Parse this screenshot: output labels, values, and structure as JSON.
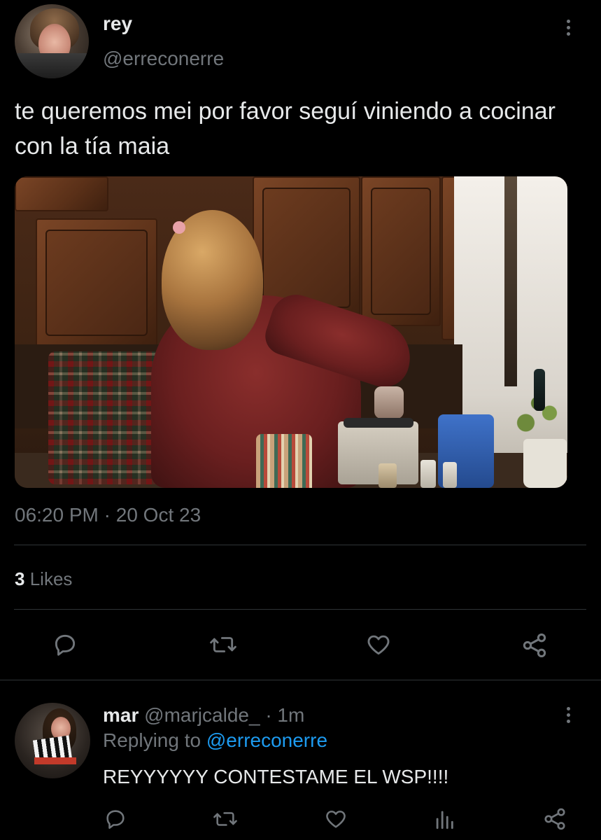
{
  "tweet": {
    "author_name": "rey",
    "author_handle": "@erreconerre",
    "text": "te queremos mei por favor seguí viniendo a cocinar con la tía maia",
    "time": "06:20 PM",
    "separator": "·",
    "date": "20 Oct 23",
    "likes_count": "3",
    "likes_label": "Likes",
    "photo_icon": "kitchen-photo",
    "actions": [
      "reply-icon",
      "retweet-icon",
      "like-icon",
      "share-icon"
    ]
  },
  "reply": {
    "author_name": "mar",
    "author_handle": "@marjcalde_",
    "time_separator": "·",
    "time_ago": "1m",
    "replying_to_label": "Replying to",
    "replying_to_handle": "@erreconerre",
    "text": "REYYYYYY CONTESTAME EL WSP!!!!",
    "actions": [
      "reply-icon",
      "retweet-icon",
      "like-icon",
      "analytics-icon",
      "share-icon"
    ]
  },
  "colors": {
    "background": "#000000",
    "text": "#e7e9ea",
    "muted": "#71767b",
    "accent": "#1d9bf0",
    "divider": "#2f3336"
  }
}
